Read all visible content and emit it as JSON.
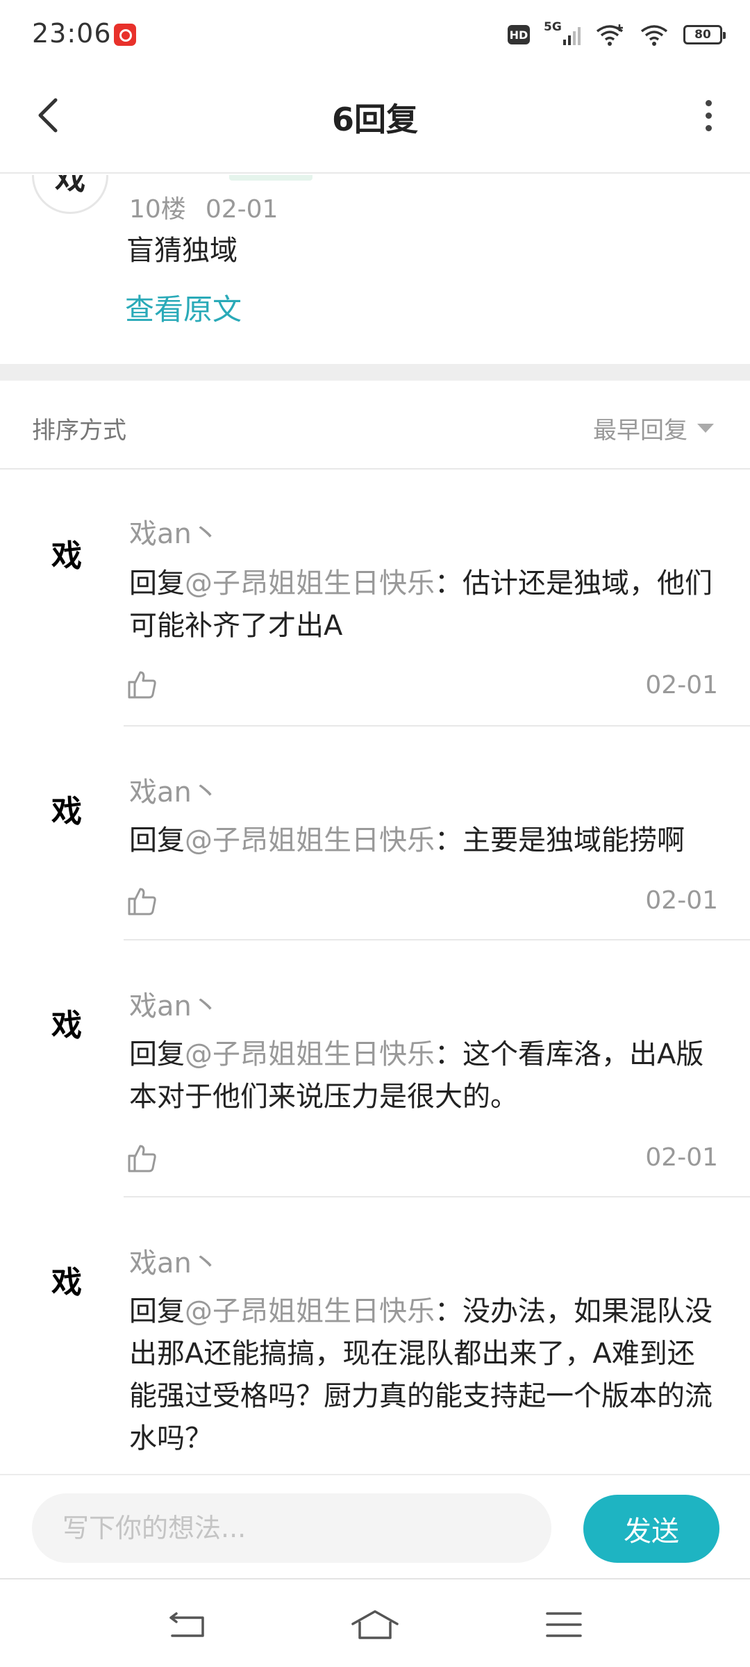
{
  "status_bar": {
    "time": "23:06",
    "hd_label": "HD",
    "network_label": "5G",
    "battery": "80"
  },
  "header": {
    "title": "6回复"
  },
  "main_post": {
    "avatar_char": "戏",
    "floor": "10楼",
    "date": "02-01",
    "content": "盲猜独域",
    "view_original": "查看原文"
  },
  "sort": {
    "label": "排序方式",
    "value": "最早回复"
  },
  "replies": [
    {
      "avatar_char": "戏",
      "name": "戏an丶",
      "prefix": "回复",
      "mention": "@子昂姐姐生日快乐",
      "text": "：估计还是独域，他们可能补齐了才出A",
      "date": "02-01"
    },
    {
      "avatar_char": "戏",
      "name": "戏an丶",
      "prefix": "回复",
      "mention": "@子昂姐姐生日快乐",
      "text": "：主要是独域能捞啊",
      "date": "02-01"
    },
    {
      "avatar_char": "戏",
      "name": "戏an丶",
      "prefix": "回复",
      "mention": "@子昂姐姐生日快乐",
      "text": "：这个看库洛，出A版本对于他们来说压力是很大的。",
      "date": "02-01"
    },
    {
      "avatar_char": "戏",
      "name": "戏an丶",
      "prefix": "回复",
      "mention": "@子昂姐姐生日快乐",
      "text": "：没办法，如果混队没出那A还能搞搞，现在混队都出来了，A难到还能强过受格吗？厨力真的能支持起一个版本的流水吗？",
      "date": ""
    }
  ],
  "input": {
    "placeholder": "写下你的想法...",
    "send_label": "发送"
  },
  "icons": {
    "back": "back-arrow-icon",
    "more": "more-vertical-icon",
    "like": "thumbs-up-icon",
    "nav_back": "nav-back-icon",
    "nav_home": "nav-home-icon",
    "nav_menu": "nav-menu-icon"
  },
  "colors": {
    "accent": "#1eb4c2",
    "link": "#2aaab8",
    "muted": "#999999"
  }
}
